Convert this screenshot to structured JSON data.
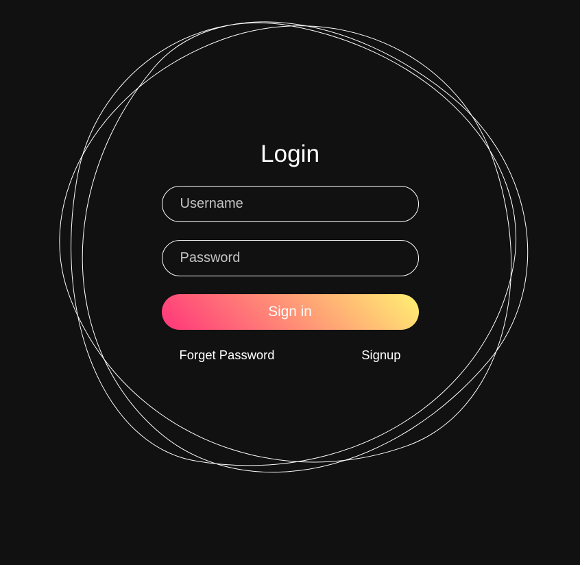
{
  "form": {
    "title": "Login",
    "username_placeholder": "Username",
    "password_placeholder": "Password",
    "submit_label": "Sign in",
    "forgot_link": "Forget Password",
    "signup_link": "Signup"
  }
}
